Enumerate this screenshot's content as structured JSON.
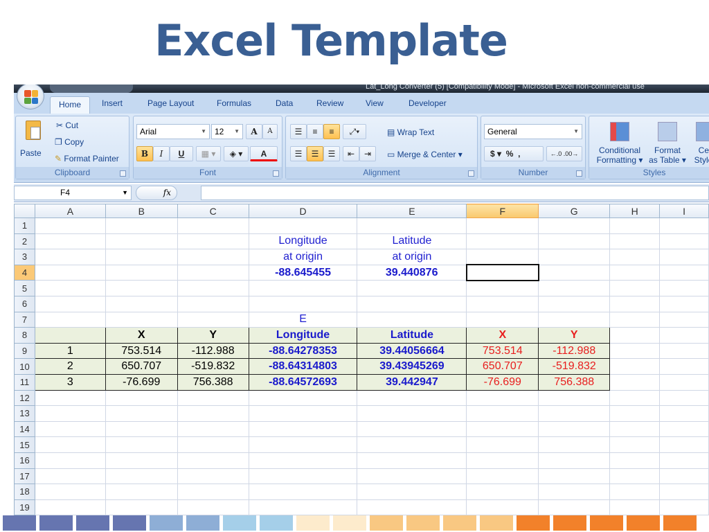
{
  "slide": {
    "title": "Excel Template"
  },
  "window": {
    "title": "Lat_Long Converter (5)  [Compatibility Mode] - Microsoft Excel non-commercial use"
  },
  "tabs": [
    "Home",
    "Insert",
    "Page Layout",
    "Formulas",
    "Data",
    "Review",
    "View",
    "Developer"
  ],
  "ribbon": {
    "clipboard": {
      "label": "Clipboard",
      "paste": "Paste",
      "cut": "Cut",
      "copy": "Copy",
      "format_painter": "Format Painter"
    },
    "font": {
      "label": "Font",
      "name": "Arial",
      "size": "12",
      "bold": "B",
      "italic": "I",
      "underline": "U",
      "grow": "A",
      "shrink": "A",
      "font_color": "A"
    },
    "alignment": {
      "label": "Alignment",
      "wrap_text": "Wrap Text",
      "merge_center": "Merge & Center"
    },
    "number": {
      "label": "Number",
      "format": "General",
      "currency": "$",
      "percent": "%",
      "comma": ","
    },
    "styles": {
      "label": "Styles",
      "conditional": "Conditional",
      "conditional2": "Formatting",
      "format_table": "Format",
      "format_table2": "as Table",
      "cell_styles": "Cell",
      "cell_styles2": "Styles"
    }
  },
  "formula_bar": {
    "name_box": "F4",
    "fx": "fx",
    "value": ""
  },
  "columns": [
    "A",
    "B",
    "C",
    "D",
    "E",
    "F",
    "G",
    "H",
    "I"
  ],
  "selected_cell": "F4",
  "rows": [
    {
      "n": "1",
      "cells": [
        "",
        "",
        "",
        "",
        "",
        "",
        "",
        "",
        ""
      ]
    },
    {
      "n": "2",
      "cells": [
        "",
        "",
        "",
        "Longitude",
        "Latitude",
        "",
        "",
        "",
        ""
      ]
    },
    {
      "n": "3",
      "cells": [
        "",
        "",
        "",
        "at origin",
        "at origin",
        "",
        "",
        "",
        ""
      ]
    },
    {
      "n": "4",
      "cells": [
        "",
        "",
        "",
        "-88.645455",
        "39.440876",
        "",
        "",
        "",
        ""
      ]
    },
    {
      "n": "5",
      "cells": [
        "",
        "",
        "",
        "",
        "",
        "",
        "",
        "",
        ""
      ]
    },
    {
      "n": "6",
      "cells": [
        "",
        "",
        "",
        "",
        "",
        "",
        "",
        "",
        ""
      ]
    },
    {
      "n": "7",
      "cells": [
        "",
        "",
        "",
        "E",
        "",
        "",
        "",
        "",
        ""
      ]
    },
    {
      "n": "8",
      "cells": [
        "",
        "X",
        "Y",
        "Longitude",
        "Latitude",
        "X",
        "Y",
        "",
        ""
      ]
    },
    {
      "n": "9",
      "cells": [
        "1",
        "753.514",
        "-112.988",
        "-88.64278353",
        "39.44056664",
        "753.514",
        "-112.988",
        "",
        ""
      ]
    },
    {
      "n": "10",
      "cells": [
        "2",
        "650.707",
        "-519.832",
        "-88.64314803",
        "39.43945269",
        "650.707",
        "-519.832",
        "",
        ""
      ]
    },
    {
      "n": "11",
      "cells": [
        "3",
        "-76.699",
        "756.388",
        "-88.64572693",
        "39.442947",
        "-76.699",
        "756.388",
        "",
        ""
      ]
    },
    {
      "n": "12",
      "cells": [
        "",
        "",
        "",
        "",
        "",
        "",
        "",
        "",
        ""
      ]
    },
    {
      "n": "13",
      "cells": [
        "",
        "",
        "",
        "",
        "",
        "",
        "",
        "",
        ""
      ]
    },
    {
      "n": "14",
      "cells": [
        "",
        "",
        "",
        "",
        "",
        "",
        "",
        "",
        ""
      ]
    },
    {
      "n": "15",
      "cells": [
        "",
        "",
        "",
        "",
        "",
        "",
        "",
        "",
        ""
      ]
    },
    {
      "n": "16",
      "cells": [
        "",
        "",
        "",
        "",
        "",
        "",
        "",
        "",
        ""
      ]
    },
    {
      "n": "17",
      "cells": [
        "",
        "",
        "",
        "",
        "",
        "",
        "",
        "",
        ""
      ]
    },
    {
      "n": "18",
      "cells": [
        "",
        "",
        "",
        "",
        "",
        "",
        "",
        "",
        ""
      ]
    },
    {
      "n": "19",
      "cells": [
        "",
        "",
        "",
        "",
        "",
        "",
        "",
        "",
        ""
      ]
    }
  ],
  "footer_colors": [
    "#6675b0",
    "#6675b0",
    "#6675b0",
    "#6675b0",
    "#8eaed6",
    "#8eaed6",
    "#a5cfe9",
    "#a5cfe9",
    "#fdebcc",
    "#fdebcc",
    "#f9c882",
    "#f9c882",
    "#f9c882",
    "#f9c882",
    "#f2812a",
    "#f2812a",
    "#f2812a",
    "#f2812a",
    "#f2812a"
  ]
}
